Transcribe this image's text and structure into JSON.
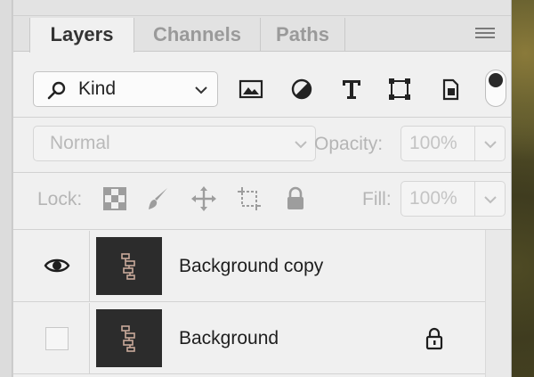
{
  "panel": {
    "tabs": [
      {
        "label": "Layers",
        "active": true
      },
      {
        "label": "Channels",
        "active": false
      },
      {
        "label": "Paths",
        "active": false
      }
    ],
    "menu_icon": "hamburger-menu-icon"
  },
  "filter": {
    "kind_label": "Kind",
    "search_icon": "magnifier-icon",
    "filter_icons": [
      "pixel-image-icon",
      "adjustment-layer-icon",
      "type-layer-icon",
      "shape-layer-icon",
      "smart-object-icon"
    ],
    "filter_toggle": "on"
  },
  "blend": {
    "mode": "Normal",
    "opacity_label": "Opacity:",
    "opacity_value": "100%",
    "lock_label": "Lock:",
    "lock_icons": [
      "lock-transparent-pixels-icon",
      "lock-image-pixels-icon",
      "lock-position-icon",
      "lock-artboard-icon",
      "lock-all-icon"
    ],
    "fill_label": "Fill:",
    "fill_value": "100%"
  },
  "layers": [
    {
      "name": "Background copy",
      "visible": true,
      "locked": false
    },
    {
      "name": "Background",
      "visible": false,
      "locked": true
    }
  ],
  "colors": {
    "panel_bg": "#f0f0f0",
    "thumbnail_bg": "#2c2c2c",
    "thumbnail_glyph": "#c9a99a"
  }
}
